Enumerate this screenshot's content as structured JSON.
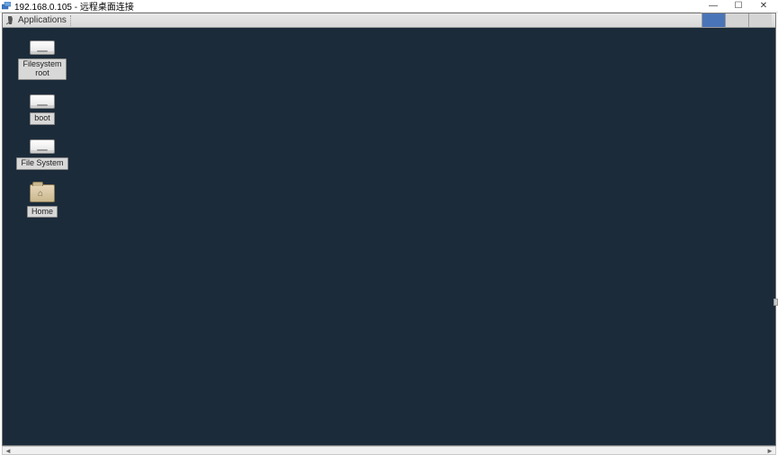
{
  "window": {
    "title": "192.168.0.105 - 远程桌面连接",
    "controls": {
      "min": "—",
      "max": "☐",
      "close": "✕"
    }
  },
  "xpanel": {
    "applications_label": "Applications"
  },
  "desktop": {
    "icons": [
      {
        "name": "filesystem-root",
        "label": "Filesystem\nroot",
        "type": "drive"
      },
      {
        "name": "boot",
        "label": "boot",
        "type": "drive"
      },
      {
        "name": "file-system",
        "label": "File System",
        "type": "drive"
      },
      {
        "name": "home",
        "label": "Home",
        "type": "home"
      }
    ]
  },
  "colors": {
    "desktop_bg": "#1b2b3a",
    "tray_active": "#4a74b8"
  }
}
